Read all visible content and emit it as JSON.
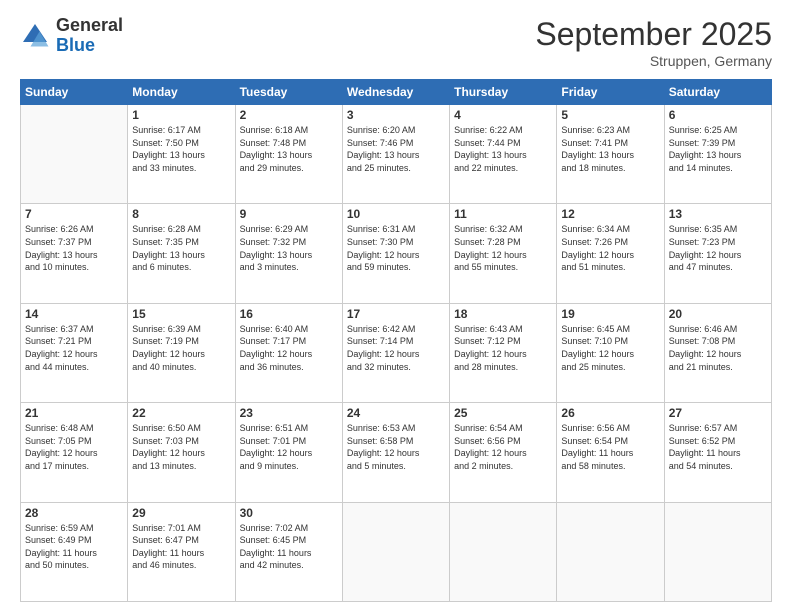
{
  "header": {
    "logo_general": "General",
    "logo_blue": "Blue",
    "month_title": "September 2025",
    "location": "Struppen, Germany"
  },
  "weekdays": [
    "Sunday",
    "Monday",
    "Tuesday",
    "Wednesday",
    "Thursday",
    "Friday",
    "Saturday"
  ],
  "weeks": [
    [
      {
        "day": "",
        "info": ""
      },
      {
        "day": "1",
        "info": "Sunrise: 6:17 AM\nSunset: 7:50 PM\nDaylight: 13 hours\nand 33 minutes."
      },
      {
        "day": "2",
        "info": "Sunrise: 6:18 AM\nSunset: 7:48 PM\nDaylight: 13 hours\nand 29 minutes."
      },
      {
        "day": "3",
        "info": "Sunrise: 6:20 AM\nSunset: 7:46 PM\nDaylight: 13 hours\nand 25 minutes."
      },
      {
        "day": "4",
        "info": "Sunrise: 6:22 AM\nSunset: 7:44 PM\nDaylight: 13 hours\nand 22 minutes."
      },
      {
        "day": "5",
        "info": "Sunrise: 6:23 AM\nSunset: 7:41 PM\nDaylight: 13 hours\nand 18 minutes."
      },
      {
        "day": "6",
        "info": "Sunrise: 6:25 AM\nSunset: 7:39 PM\nDaylight: 13 hours\nand 14 minutes."
      }
    ],
    [
      {
        "day": "7",
        "info": "Sunrise: 6:26 AM\nSunset: 7:37 PM\nDaylight: 13 hours\nand 10 minutes."
      },
      {
        "day": "8",
        "info": "Sunrise: 6:28 AM\nSunset: 7:35 PM\nDaylight: 13 hours\nand 6 minutes."
      },
      {
        "day": "9",
        "info": "Sunrise: 6:29 AM\nSunset: 7:32 PM\nDaylight: 13 hours\nand 3 minutes."
      },
      {
        "day": "10",
        "info": "Sunrise: 6:31 AM\nSunset: 7:30 PM\nDaylight: 12 hours\nand 59 minutes."
      },
      {
        "day": "11",
        "info": "Sunrise: 6:32 AM\nSunset: 7:28 PM\nDaylight: 12 hours\nand 55 minutes."
      },
      {
        "day": "12",
        "info": "Sunrise: 6:34 AM\nSunset: 7:26 PM\nDaylight: 12 hours\nand 51 minutes."
      },
      {
        "day": "13",
        "info": "Sunrise: 6:35 AM\nSunset: 7:23 PM\nDaylight: 12 hours\nand 47 minutes."
      }
    ],
    [
      {
        "day": "14",
        "info": "Sunrise: 6:37 AM\nSunset: 7:21 PM\nDaylight: 12 hours\nand 44 minutes."
      },
      {
        "day": "15",
        "info": "Sunrise: 6:39 AM\nSunset: 7:19 PM\nDaylight: 12 hours\nand 40 minutes."
      },
      {
        "day": "16",
        "info": "Sunrise: 6:40 AM\nSunset: 7:17 PM\nDaylight: 12 hours\nand 36 minutes."
      },
      {
        "day": "17",
        "info": "Sunrise: 6:42 AM\nSunset: 7:14 PM\nDaylight: 12 hours\nand 32 minutes."
      },
      {
        "day": "18",
        "info": "Sunrise: 6:43 AM\nSunset: 7:12 PM\nDaylight: 12 hours\nand 28 minutes."
      },
      {
        "day": "19",
        "info": "Sunrise: 6:45 AM\nSunset: 7:10 PM\nDaylight: 12 hours\nand 25 minutes."
      },
      {
        "day": "20",
        "info": "Sunrise: 6:46 AM\nSunset: 7:08 PM\nDaylight: 12 hours\nand 21 minutes."
      }
    ],
    [
      {
        "day": "21",
        "info": "Sunrise: 6:48 AM\nSunset: 7:05 PM\nDaylight: 12 hours\nand 17 minutes."
      },
      {
        "day": "22",
        "info": "Sunrise: 6:50 AM\nSunset: 7:03 PM\nDaylight: 12 hours\nand 13 minutes."
      },
      {
        "day": "23",
        "info": "Sunrise: 6:51 AM\nSunset: 7:01 PM\nDaylight: 12 hours\nand 9 minutes."
      },
      {
        "day": "24",
        "info": "Sunrise: 6:53 AM\nSunset: 6:58 PM\nDaylight: 12 hours\nand 5 minutes."
      },
      {
        "day": "25",
        "info": "Sunrise: 6:54 AM\nSunset: 6:56 PM\nDaylight: 12 hours\nand 2 minutes."
      },
      {
        "day": "26",
        "info": "Sunrise: 6:56 AM\nSunset: 6:54 PM\nDaylight: 11 hours\nand 58 minutes."
      },
      {
        "day": "27",
        "info": "Sunrise: 6:57 AM\nSunset: 6:52 PM\nDaylight: 11 hours\nand 54 minutes."
      }
    ],
    [
      {
        "day": "28",
        "info": "Sunrise: 6:59 AM\nSunset: 6:49 PM\nDaylight: 11 hours\nand 50 minutes."
      },
      {
        "day": "29",
        "info": "Sunrise: 7:01 AM\nSunset: 6:47 PM\nDaylight: 11 hours\nand 46 minutes."
      },
      {
        "day": "30",
        "info": "Sunrise: 7:02 AM\nSunset: 6:45 PM\nDaylight: 11 hours\nand 42 minutes."
      },
      {
        "day": "",
        "info": ""
      },
      {
        "day": "",
        "info": ""
      },
      {
        "day": "",
        "info": ""
      },
      {
        "day": "",
        "info": ""
      }
    ]
  ]
}
